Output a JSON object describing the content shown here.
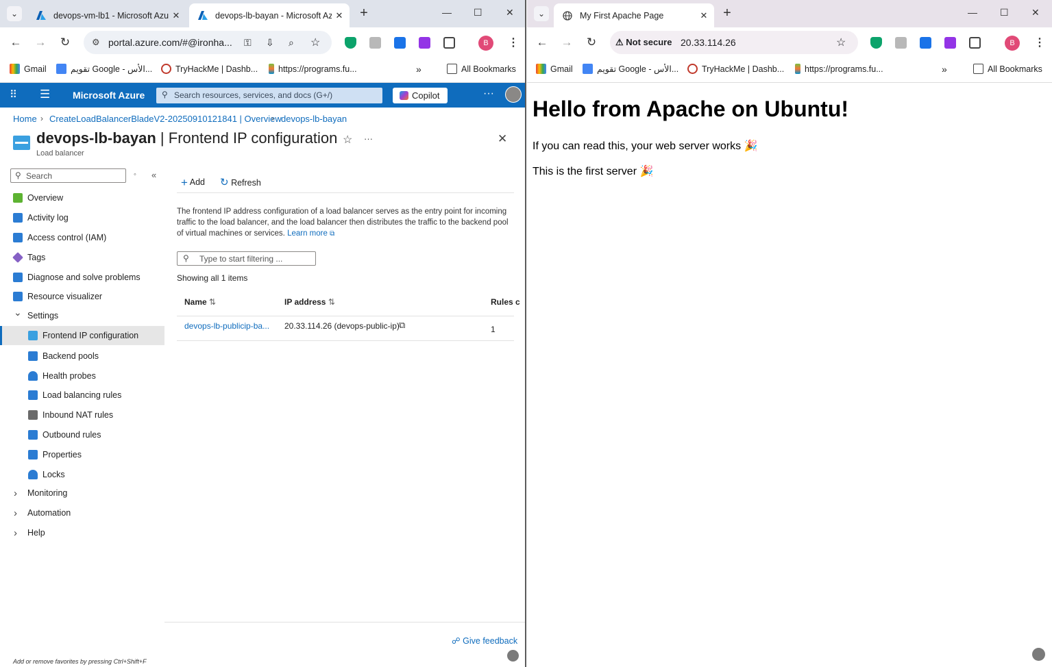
{
  "left_window": {
    "tabs": [
      {
        "title": "devops-vm-lb1 - Microsoft Azu",
        "active": false
      },
      {
        "title": "devops-lb-bayan - Microsoft Az",
        "active": true
      }
    ],
    "url": "portal.azure.com/#@ironha...",
    "bookmarks": [
      {
        "label": "Gmail"
      },
      {
        "label": "تقويم Google - الأس..."
      },
      {
        "label": "TryHackMe | Dashb..."
      },
      {
        "label": "https://programs.fu..."
      }
    ],
    "all_bookmarks": "All Bookmarks",
    "avatar_letter": "B"
  },
  "azure": {
    "brand": "Microsoft Azure",
    "search_placeholder": "Search resources, services, and docs (G+/)",
    "copilot": "Copilot",
    "breadcrumb": [
      "Home",
      "CreateLoadBalancerBladeV2-20250910121841 | Overview",
      "devops-lb-bayan"
    ],
    "resource_name": "devops-lb-bayan",
    "title_sep": " | ",
    "page_name": "Frontend IP configuration",
    "resource_type": "Load balancer",
    "menu_search": "Search",
    "nav": [
      {
        "label": "Overview",
        "icon": "overview-icon",
        "color": "#5db332"
      },
      {
        "label": "Activity log",
        "icon": "activity-log-icon",
        "color": "#2b7cd3"
      },
      {
        "label": "Access control (IAM)",
        "icon": "iam-icon",
        "color": "#2b7cd3"
      },
      {
        "label": "Tags",
        "icon": "tag-icon",
        "color": "#8661c5"
      },
      {
        "label": "Diagnose and solve problems",
        "icon": "wrench-icon",
        "color": "#2b7cd3"
      },
      {
        "label": "Resource visualizer",
        "icon": "visualizer-icon",
        "color": "#2b7cd3"
      },
      {
        "label": "Settings",
        "icon": "chevron-down-icon",
        "color": "#444"
      },
      {
        "label": "Frontend IP configuration",
        "icon": "frontend-ip-icon",
        "color": "#3aa0e0"
      },
      {
        "label": "Backend pools",
        "icon": "backend-pools-icon",
        "color": "#2b7cd3"
      },
      {
        "label": "Health probes",
        "icon": "health-probe-icon",
        "color": "#2b7cd3"
      },
      {
        "label": "Load balancing rules",
        "icon": "rules-icon",
        "color": "#2b7cd3"
      },
      {
        "label": "Inbound NAT rules",
        "icon": "inbound-nat-icon",
        "color": "#6a6a6a"
      },
      {
        "label": "Outbound rules",
        "icon": "outbound-icon",
        "color": "#2b7cd3"
      },
      {
        "label": "Properties",
        "icon": "properties-icon",
        "color": "#2b7cd3"
      },
      {
        "label": "Locks",
        "icon": "lock-icon",
        "color": "#2b7cd3"
      },
      {
        "label": "Monitoring",
        "icon": "chevron-right-icon",
        "color": "#444"
      },
      {
        "label": "Automation",
        "icon": "chevron-right-icon",
        "color": "#444"
      },
      {
        "label": "Help",
        "icon": "chevron-right-icon",
        "color": "#444"
      }
    ],
    "cmd_add": "Add",
    "cmd_refresh": "Refresh",
    "description": "The frontend IP address configuration of a load balancer serves as the entry point for incoming traffic to the load balancer, and the load balancer then distributes the traffic to the backend pool of virtual machines or services.",
    "learn_more": "Learn more",
    "filter_placeholder": "Type to start filtering ...",
    "showing": "Showing all 1 items",
    "table": {
      "headers": [
        "Name",
        "IP address",
        "Rules c"
      ],
      "rows": [
        {
          "name": "devops-lb-publicip-ba...",
          "ip": "20.33.114.26 (devops-public-ip)",
          "rules": "1"
        }
      ]
    },
    "feedback": "Give feedback",
    "fav_hint": "Add or remove favorites by pressing Ctrl+Shift+F"
  },
  "right_window": {
    "tab_title": "My First Apache Page",
    "security": "Not secure",
    "url": "20.33.114.26",
    "bookmarks": [
      {
        "label": "Gmail"
      },
      {
        "label": "تقويم Google - الأس..."
      },
      {
        "label": "TryHackMe | Dashb..."
      },
      {
        "label": "https://programs.fu..."
      }
    ],
    "all_bookmarks": "All Bookmarks",
    "avatar_letter": "B",
    "page": {
      "heading": "Hello from Apache on Ubuntu!",
      "line1": "If you can read this, your web server works 🎉",
      "line2": "This is the first server 🎉"
    }
  }
}
